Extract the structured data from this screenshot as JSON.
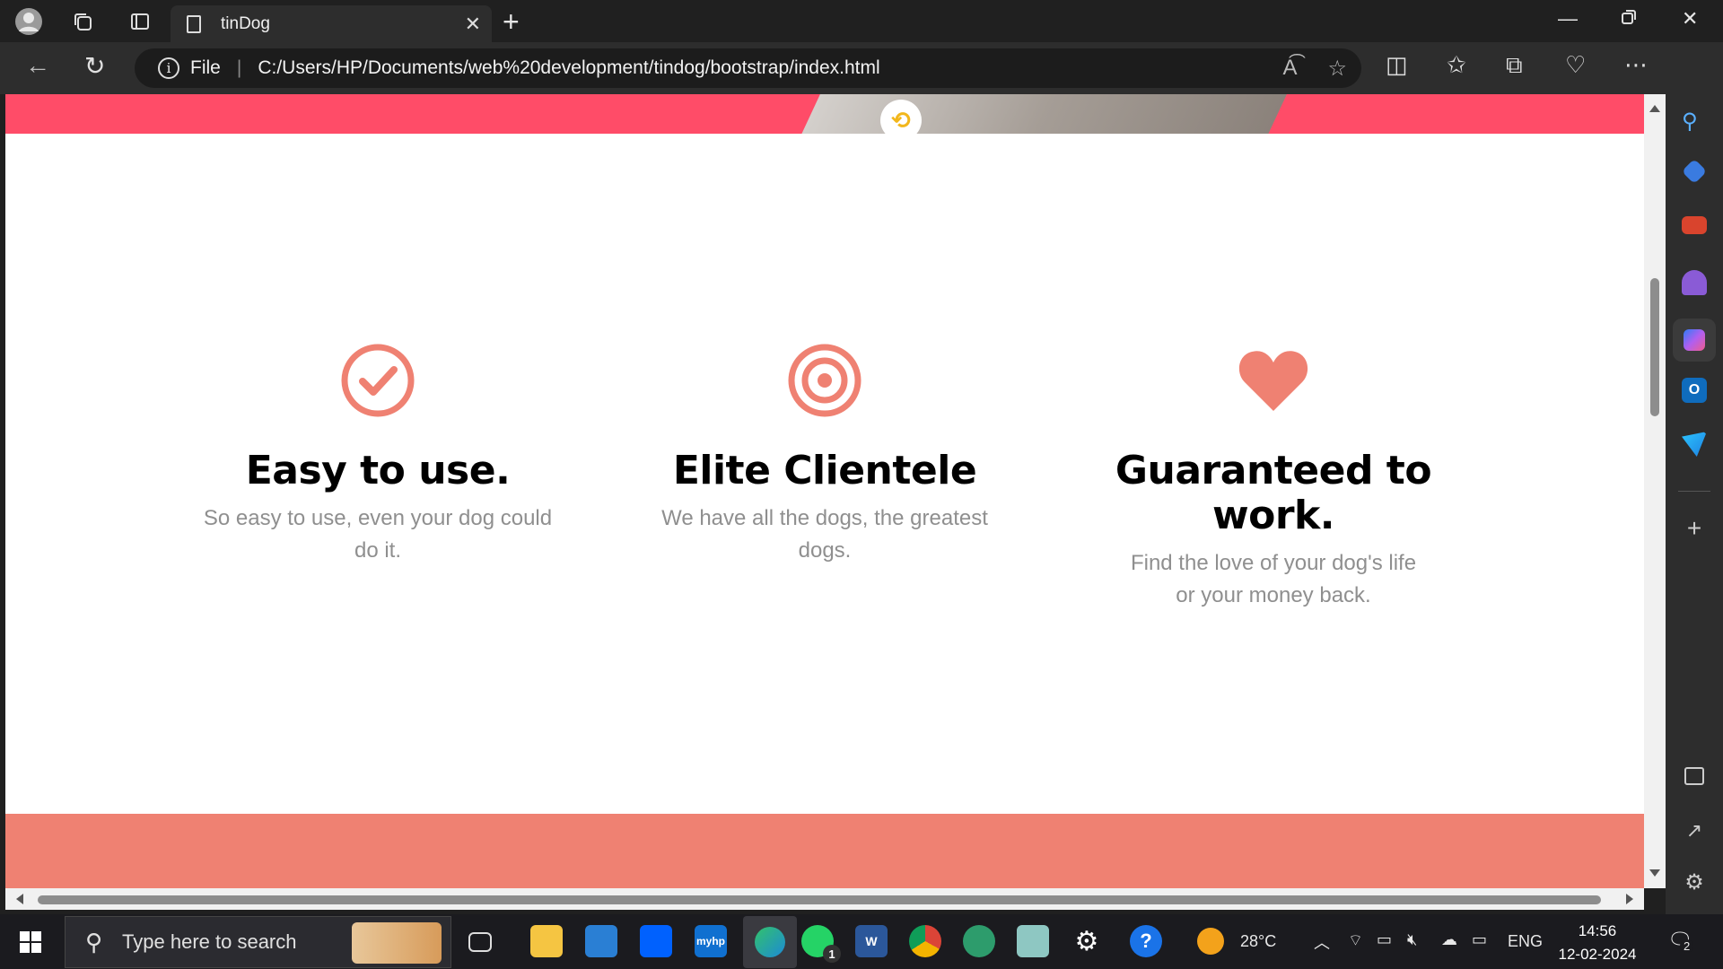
{
  "browser": {
    "tab_title": "tinDog",
    "address_scheme": "File",
    "address_url": "C:/Users/HP/Documents/web%20development/tindog/bootstrap/index.html"
  },
  "features": [
    {
      "icon": "check-circle-icon",
      "title": "Easy to use.",
      "text": "So easy to use, even your dog could do it."
    },
    {
      "icon": "bullseye-icon",
      "title": "Elite Clientele",
      "text": "We have all the dogs, the greatest dogs."
    },
    {
      "icon": "heart-icon",
      "title": "Guaranteed to work.",
      "text": "Find the love of your dog's life or your money back."
    }
  ],
  "colors": {
    "hero": "#ff4c68",
    "accent": "#ef8172",
    "muted_text": "#8f8f8f"
  },
  "taskbar": {
    "search_placeholder": "Type here to search",
    "weather": "28°C",
    "language": "ENG",
    "time": "14:56",
    "date": "12-02-2024",
    "whatsapp_badge": "1",
    "notification_count": "2"
  }
}
